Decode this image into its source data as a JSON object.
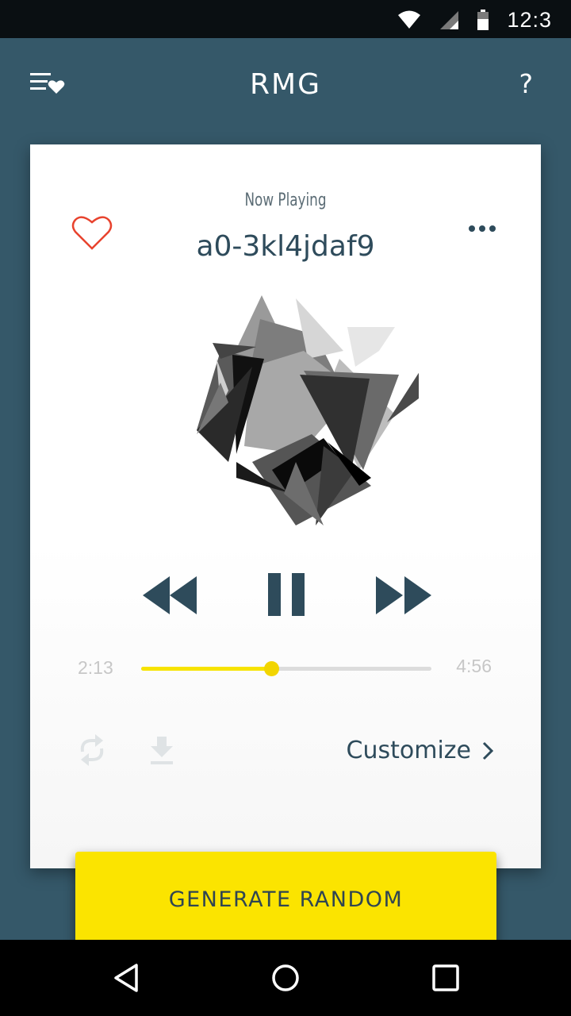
{
  "status_bar": {
    "time": "12:3",
    "icons": [
      "wifi-icon",
      "signal-icon",
      "battery-icon"
    ]
  },
  "header": {
    "title": "RMG",
    "menu_icon": "playlist-heart-icon",
    "help_label": "?"
  },
  "player": {
    "now_playing_label": "Now Playing",
    "track_title": "a0-3kl4jdaf9",
    "favorite_icon": "heart-outline-icon",
    "more_icon": "more-dots-icon",
    "controls": [
      "rewind-icon",
      "pause-icon",
      "fast-forward-icon"
    ],
    "elapsed": "2:13",
    "total": "4:56",
    "progress": 0.45,
    "customize_label": "Customize"
  },
  "actions": {
    "generate_label": "GENERATE RANDOM"
  },
  "colors": {
    "background": "#355869",
    "accent": "#fbe400",
    "text_dark": "#2e4b5b",
    "heart": "#e8432e"
  },
  "nav": [
    "back-icon",
    "home-icon",
    "recents-icon"
  ]
}
